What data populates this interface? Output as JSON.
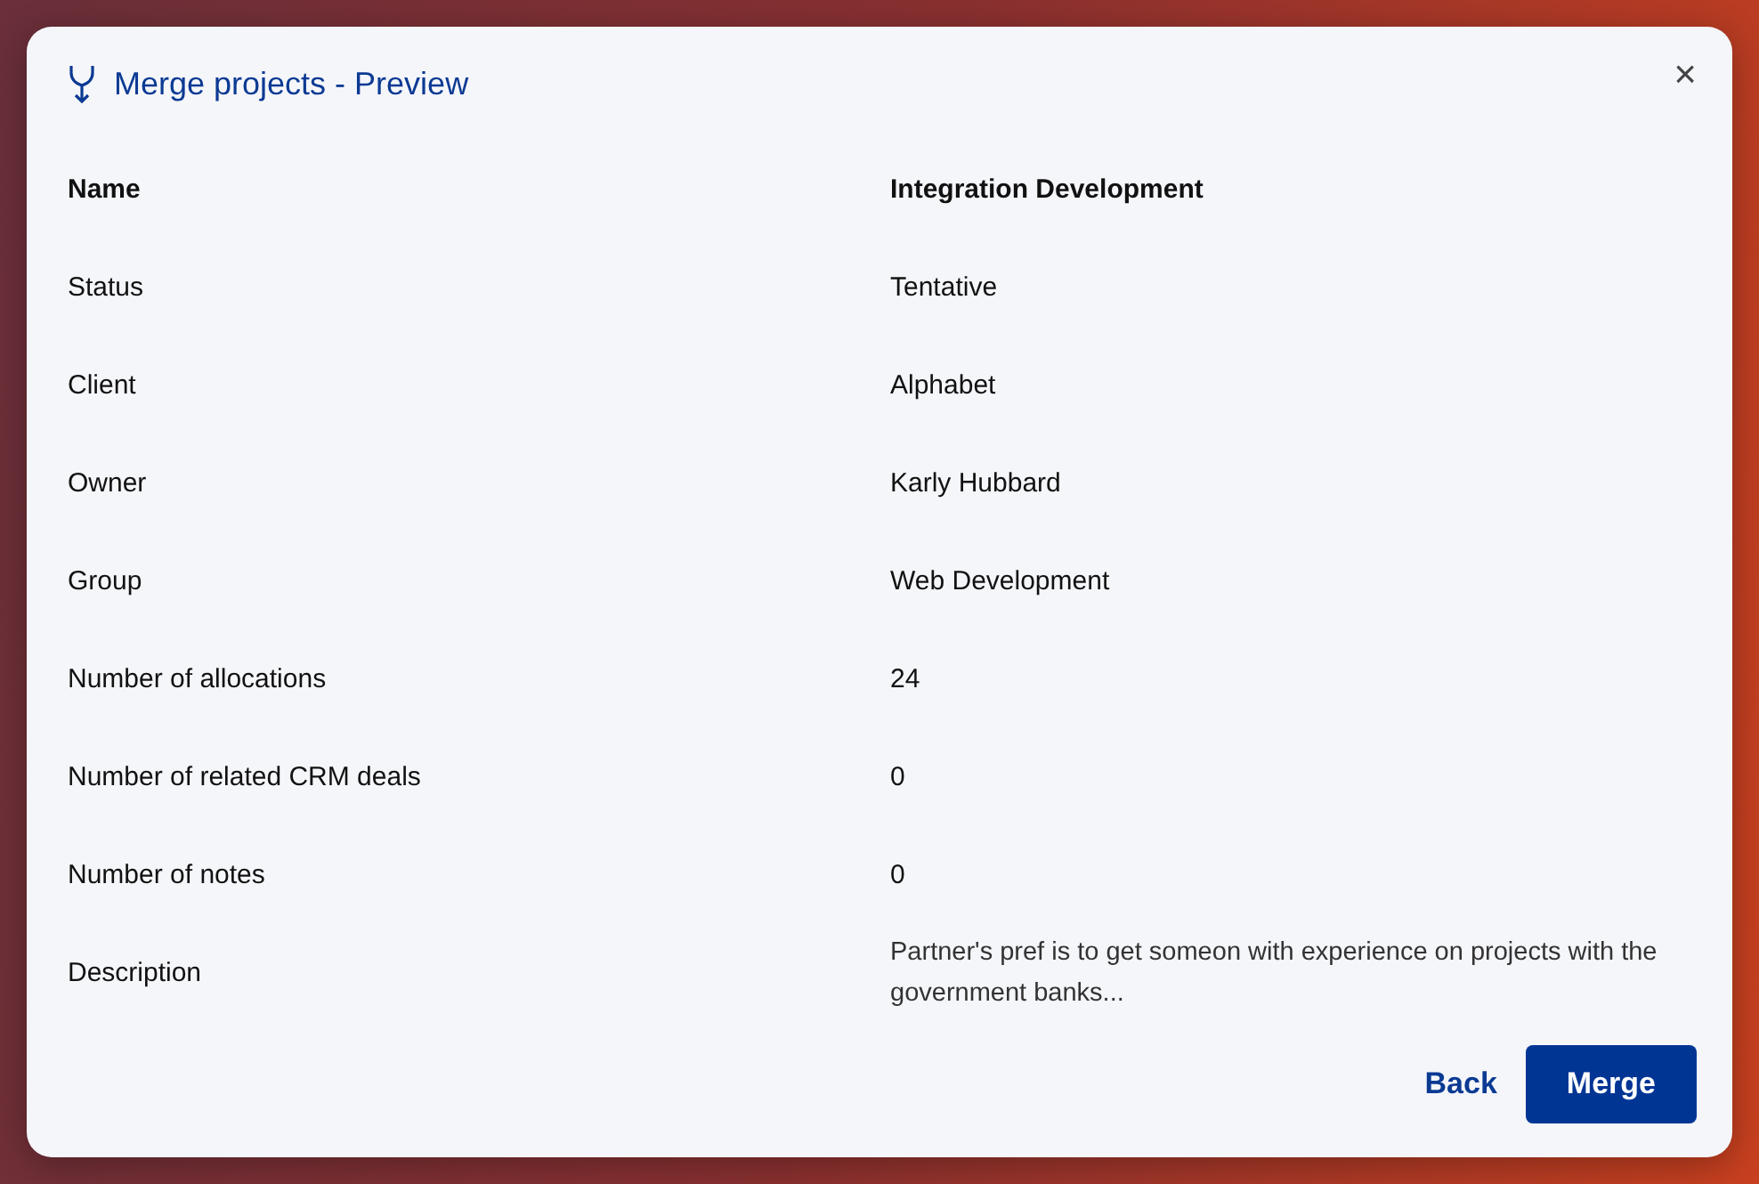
{
  "dialog": {
    "title": "Merge projects - Preview",
    "close": "×"
  },
  "rows": [
    {
      "kind": "heading",
      "label": "Name",
      "value": "Integration Development"
    },
    {
      "kind": "field",
      "label": "Status",
      "value": "Tentative"
    },
    {
      "kind": "field",
      "label": "Client",
      "value": "Alphabet"
    },
    {
      "kind": "field",
      "label": "Owner",
      "value": "Karly Hubbard"
    },
    {
      "kind": "field",
      "label": "Group",
      "value": "Web Development"
    },
    {
      "kind": "field",
      "label": "Number of allocations",
      "value": "24"
    },
    {
      "kind": "field",
      "label": "Number of related CRM deals",
      "value": "0"
    },
    {
      "kind": "field",
      "label": "Number of notes",
      "value": "0"
    },
    {
      "kind": "field",
      "label": "Description",
      "value": "Partner's pref is to get someon with experience on projects with the government banks..."
    }
  ],
  "buttons": [
    {
      "kind": "link",
      "label": "Back"
    },
    {
      "kind": "primary",
      "label": "Merge"
    }
  ]
}
